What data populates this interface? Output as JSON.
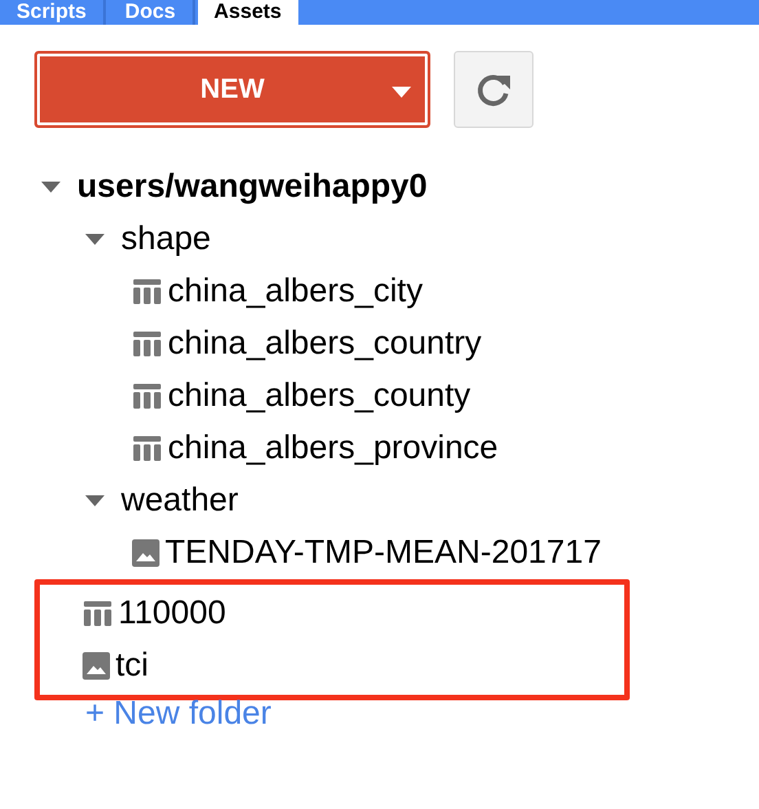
{
  "tabs": [
    {
      "label": "Scripts",
      "selected": false
    },
    {
      "label": "Docs",
      "selected": false
    },
    {
      "label": "Assets",
      "selected": true
    }
  ],
  "new_button": {
    "label": "NEW"
  },
  "tree": {
    "label": "users/wangweihappy0",
    "kind": "folder",
    "expanded": true,
    "children": [
      {
        "label": "shape",
        "kind": "folder",
        "expanded": true,
        "highlighted": false,
        "children": [
          {
            "label": "china_albers_city",
            "kind": "table"
          },
          {
            "label": "china_albers_country",
            "kind": "table"
          },
          {
            "label": "china_albers_county",
            "kind": "table"
          },
          {
            "label": "china_albers_province",
            "kind": "table"
          }
        ]
      },
      {
        "label": "weather",
        "kind": "folder",
        "expanded": true,
        "highlighted": false,
        "children": [
          {
            "label": "TENDAY-TMP-MEAN-201717",
            "kind": "image"
          }
        ]
      },
      {
        "label": "110000",
        "kind": "table",
        "highlighted": true
      },
      {
        "label": "tci",
        "kind": "image",
        "highlighted": true
      }
    ]
  },
  "new_folder_link": {
    "label": "+ New folder"
  }
}
